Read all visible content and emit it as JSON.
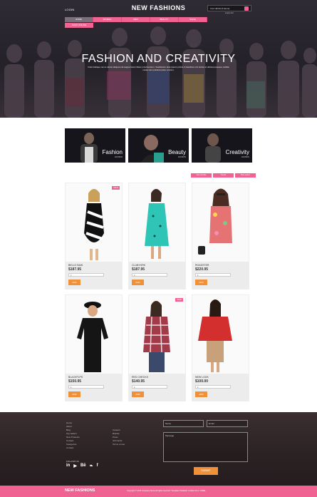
{
  "header": {
    "login_label": "LOGIN",
    "brand": "NEW FASHIONS",
    "cart_label": "Cart: $0.00 (0 items)",
    "cart_sub": "empty cart"
  },
  "nav": {
    "items": [
      "HOME",
      "WOMEN",
      "MEN",
      "BEAUTY",
      "SHOE"
    ],
    "subitem": "SHOP ONLINE"
  },
  "hero": {
    "title": "FASHION AND CREATIVITY",
    "subtitle": "Duis tristique non a varius aliquam sit augue lorem libero a fermentum. Vestibulum ante ipsum primis in faucibus orci luctus et ultrices posuere cubilia curae nam pulvinar justo a lorem."
  },
  "categories": [
    {
      "name": "Fashion",
      "sub": "FASHION"
    },
    {
      "name": "Beauty",
      "sub": "FASHION"
    },
    {
      "name": "Creativity",
      "sub": "FASHION"
    }
  ],
  "filter_tabs": [
    "New arrivals",
    "Trends",
    "Best sellers"
  ],
  "products": [
    {
      "name": "BELLO B&W",
      "price": "$187.95",
      "qty": "1",
      "add": "ADD",
      "badge": "SALE",
      "color": "#111111"
    },
    {
      "name": "CLUBYORK",
      "price": "$187.95",
      "qty": "1",
      "add": "ADD",
      "badge": "",
      "color": "#2ec4b6"
    },
    {
      "name": "ROADSTER",
      "price": "$220.95",
      "qty": "1",
      "add": "ADD",
      "badge": "",
      "color": "#e57373"
    },
    {
      "name": "BLACKFLPS",
      "price": "$150.95",
      "qty": "1",
      "add": "ADD",
      "badge": "",
      "color": "#111111"
    },
    {
      "name": "RED CHECKS",
      "price": "$140.95",
      "qty": "1",
      "add": "ADD",
      "badge": "SALE",
      "color": "#a33a4a"
    },
    {
      "name": "NEW LOOK",
      "price": "$100.00",
      "qty": "1",
      "add": "ADD",
      "badge": "",
      "color": "#d32f2f"
    }
  ],
  "footer": {
    "links": [
      "Home",
      "About",
      "Blog",
      "Top Sellers",
      "New Products",
      "Contact",
      "Categories",
      "Contact"
    ],
    "links2": [
      "Careers",
      "Brands",
      "Press",
      "Gift Cards",
      "Terms of use"
    ],
    "follow_label": "FOLLOW US",
    "social": [
      "in",
      "▶",
      "Bē",
      "❧",
      "f"
    ],
    "name_placeholder": "Name",
    "email_placeholder": "Email",
    "message_placeholder": "Message",
    "send_label": "SUBMIT"
  },
  "bottom": {
    "brand": "NEW FASHIONS",
    "copyright": "Copyright © 2015 Company Name All rights reserved. Template: PHLEGO  |  Collect from • FREE"
  },
  "colors": {
    "accent": "#f06292",
    "button": "#f0913a",
    "footer": "#2b2224"
  }
}
